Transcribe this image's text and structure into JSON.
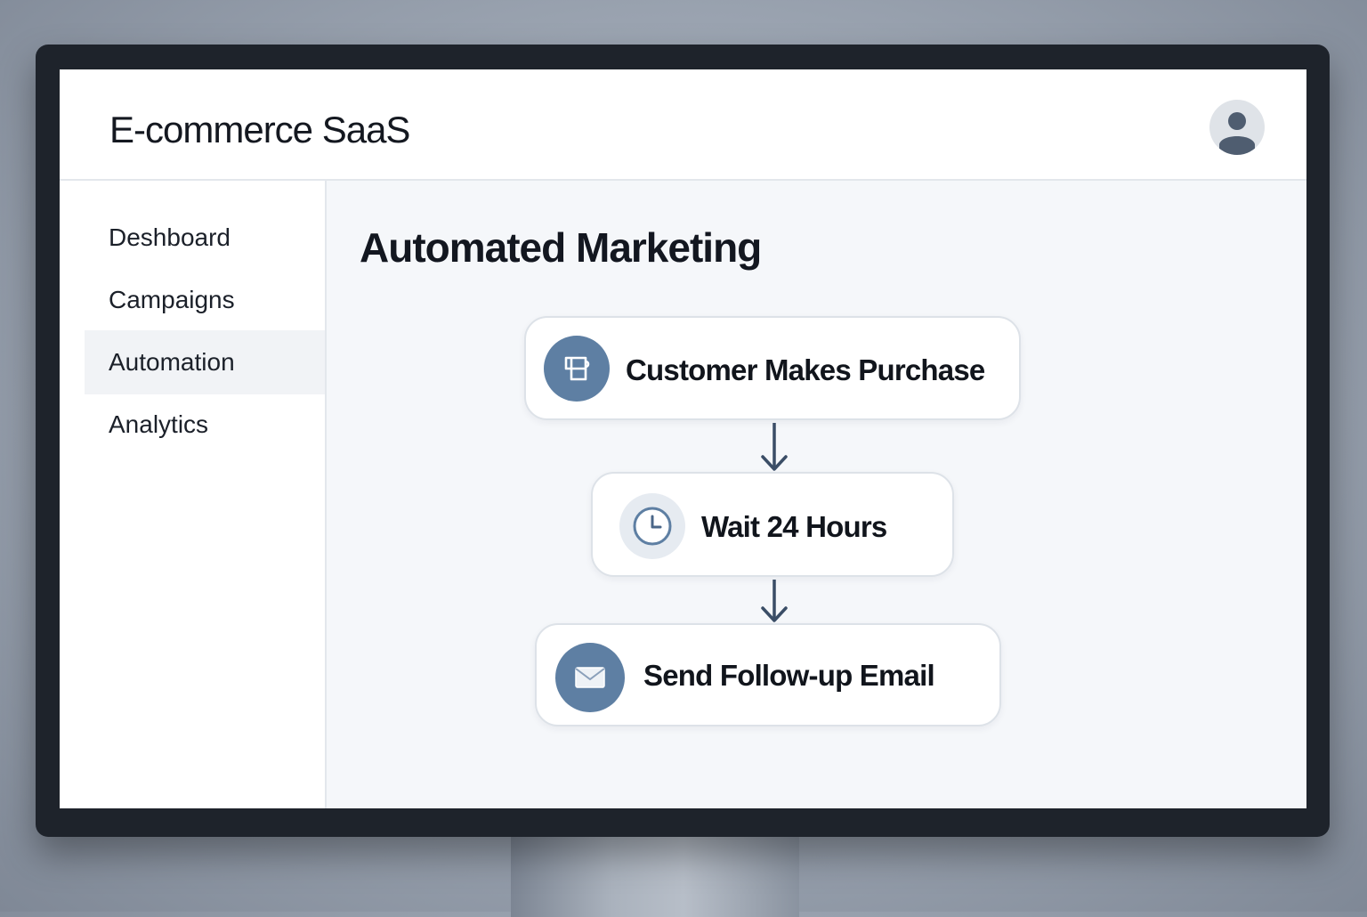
{
  "app": {
    "title": "E-commerce SaaS"
  },
  "user": {
    "avatar_icon": "user-avatar-icon"
  },
  "sidebar": {
    "items": [
      {
        "label": "Deshboard",
        "active": false
      },
      {
        "label": "Campaigns",
        "active": false
      },
      {
        "label": "Automation",
        "active": true
      },
      {
        "label": "Analytics",
        "active": false
      }
    ]
  },
  "main": {
    "title": "Automated Marketing",
    "workflow": [
      {
        "label": "Customer Makes Purchase",
        "icon": "shopping-bag-icon"
      },
      {
        "label": "Wait 24 Hours",
        "icon": "clock-icon"
      },
      {
        "label": "Send Follow-up Email",
        "icon": "envelope-icon"
      }
    ]
  },
  "colors": {
    "accent": "#5e7fa3",
    "connector": "#3a4d66",
    "active_nav_bg": "#f1f3f6"
  }
}
